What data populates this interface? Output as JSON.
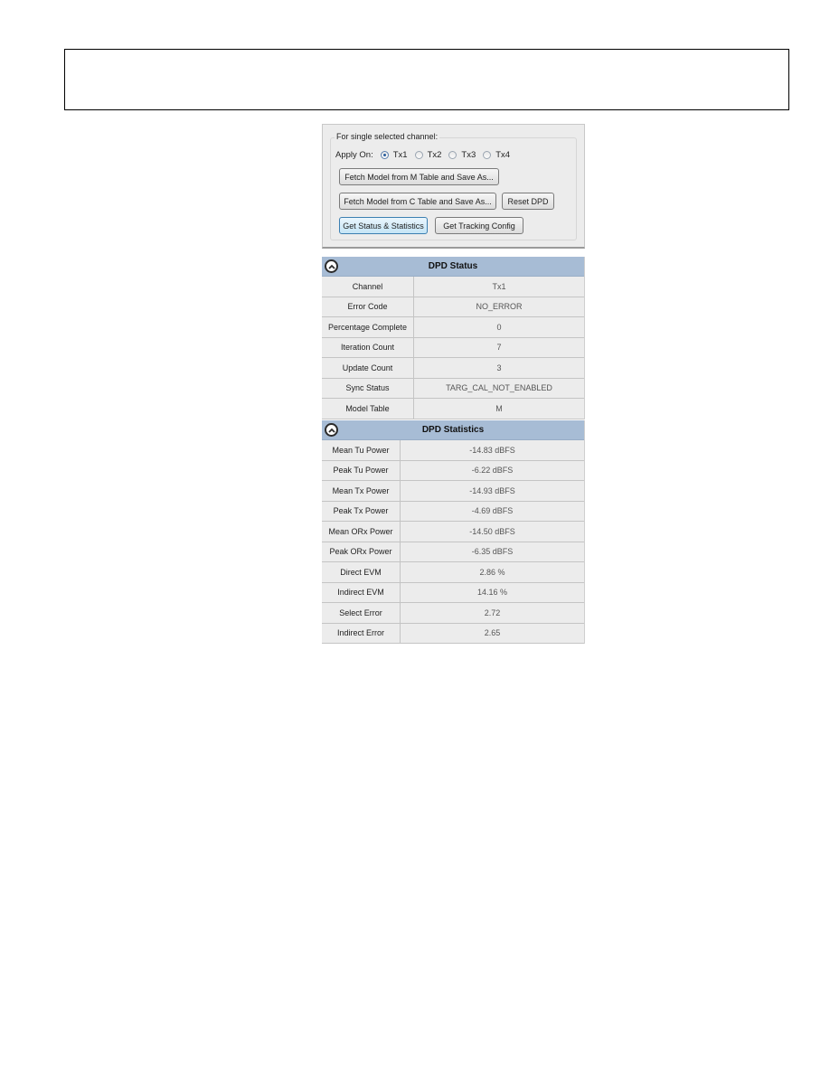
{
  "channel_panel": {
    "group_label": "For single selected channel:",
    "apply_on_label": "Apply On:",
    "radios": [
      {
        "label": "Tx1",
        "checked": true
      },
      {
        "label": "Tx2",
        "checked": false
      },
      {
        "label": "Tx3",
        "checked": false
      },
      {
        "label": "Tx4",
        "checked": false
      }
    ],
    "buttons": {
      "fetch_m": "Fetch Model from M Table and Save As...",
      "fetch_c": "Fetch Model from C Table and Save As...",
      "reset_dpd": "Reset DPD",
      "get_status": "Get Status & Statistics",
      "get_tracking": "Get Tracking Config"
    }
  },
  "dpd_status": {
    "title": "DPD Status",
    "toggle_icon": "collapse-up-icon",
    "rows": [
      {
        "label": "Channel",
        "value": "Tx1"
      },
      {
        "label": "Error Code",
        "value": "NO_ERROR"
      },
      {
        "label": "Percentage Complete",
        "value": "0"
      },
      {
        "label": "Iteration Count",
        "value": "7"
      },
      {
        "label": "Update Count",
        "value": "3"
      },
      {
        "label": "Sync Status",
        "value": "TARG_CAL_NOT_ENABLED"
      },
      {
        "label": "Model Table",
        "value": "M"
      }
    ]
  },
  "dpd_statistics": {
    "title": "DPD Statistics",
    "toggle_icon": "collapse-up-icon",
    "rows": [
      {
        "label": "Mean Tu Power",
        "value": "-14.83 dBFS"
      },
      {
        "label": "Peak Tu Power",
        "value": "-6.22 dBFS"
      },
      {
        "label": "Mean Tx Power",
        "value": "-14.93 dBFS"
      },
      {
        "label": "Peak Tx Power",
        "value": "-4.69 dBFS"
      },
      {
        "label": "Mean ORx Power",
        "value": "-14.50 dBFS"
      },
      {
        "label": "Peak ORx Power",
        "value": "-6.35 dBFS"
      },
      {
        "label": "Direct EVM",
        "value": "2.86 %"
      },
      {
        "label": "Indirect EVM",
        "value": "14.16 %"
      },
      {
        "label": "Select Error",
        "value": "2.72"
      },
      {
        "label": "Indirect Error",
        "value": "2.65"
      }
    ]
  },
  "colors": {
    "header_bg": "#a7bcd5",
    "panel_bg": "#ececec",
    "focus_border": "#3c7fb1"
  }
}
